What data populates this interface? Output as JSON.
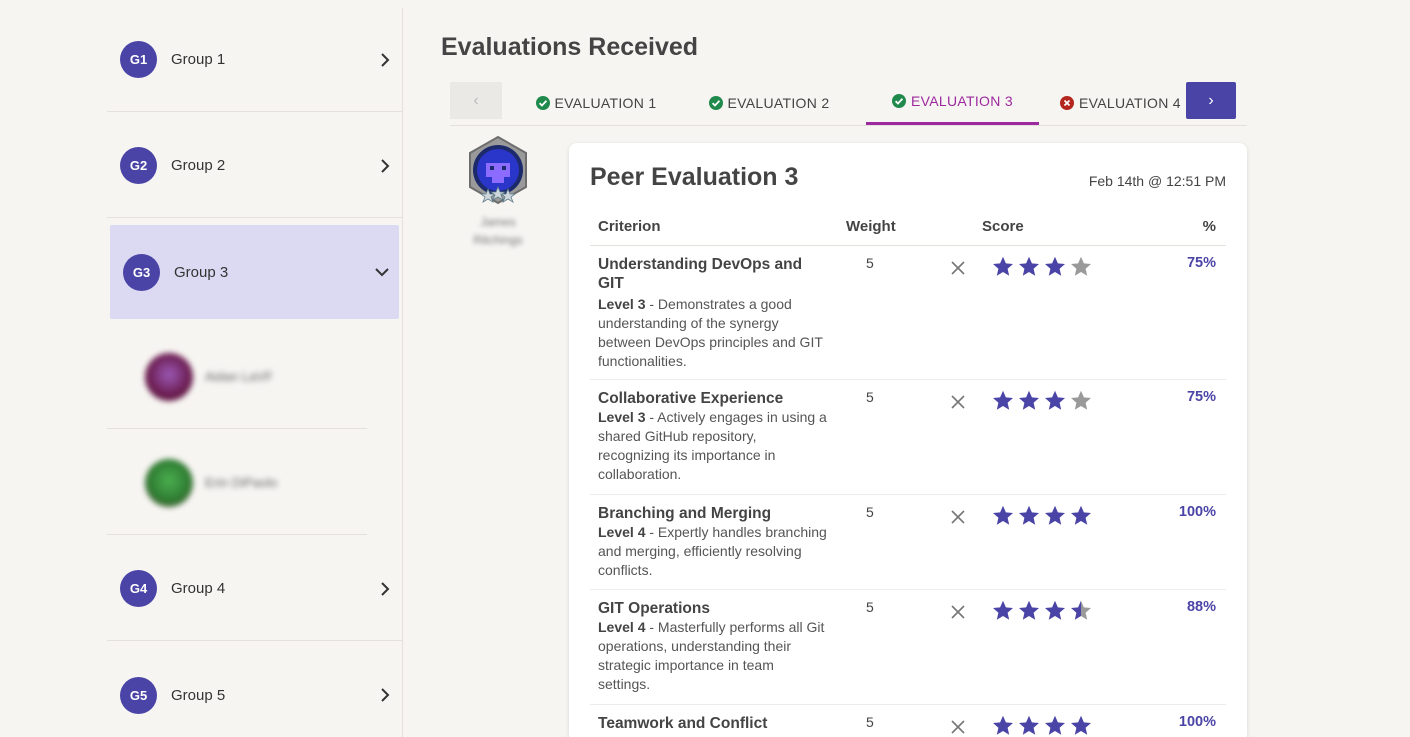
{
  "sidebar": {
    "groups": [
      {
        "initials": "G1",
        "label": "Group 1"
      },
      {
        "initials": "G2",
        "label": "Group 2"
      },
      {
        "initials": "G3",
        "label": "Group 3"
      },
      {
        "initials": "G4",
        "label": "Group 4"
      },
      {
        "initials": "G5",
        "label": "Group 5"
      }
    ],
    "members": [
      {
        "name": "Aidan LaVF"
      },
      {
        "name": "Erin DiPaolo"
      }
    ]
  },
  "main": {
    "title": "Evaluations Received",
    "tabs": [
      {
        "label": "EVALUATION 1",
        "status": "complete"
      },
      {
        "label": "EVALUATION 2",
        "status": "complete"
      },
      {
        "label": "EVALUATION 3",
        "status": "complete"
      },
      {
        "label": "EVALUATION 4",
        "status": "incomplete"
      }
    ],
    "prev_label": "‹",
    "next_label": "›",
    "evaluator": {
      "name_line1": "James",
      "name_line2": "Ritchings"
    },
    "card": {
      "title": "Peer Evaluation 3",
      "date": "Feb 14th @ 12:51 PM",
      "headers": {
        "criterion": "Criterion",
        "weight": "Weight",
        "score": "Score",
        "percent": "%"
      },
      "criteria": [
        {
          "name": "Understanding DevOps and GIT",
          "level": "Level 3",
          "desc": " - Demonstrates a good understanding of the synergy between DevOps principles and GIT functionalities.",
          "weight": "5",
          "rating": 3,
          "percent": "75%"
        },
        {
          "name": "Collaborative Experience",
          "level": "Level 3",
          "desc": " - Actively engages in using a shared GitHub repository, recognizing its importance in collaboration.",
          "weight": "5",
          "rating": 3,
          "percent": "75%"
        },
        {
          "name": "Branching and Merging",
          "level": "Level 4",
          "desc": " - Expertly handles branching and merging, efficiently resolving conflicts.",
          "weight": "5",
          "rating": 4,
          "percent": "100%"
        },
        {
          "name": "GIT Operations",
          "level": "Level 4",
          "desc": " - Masterfully performs all Git operations, understanding their strategic importance in team settings.",
          "weight": "5",
          "rating": 3.5,
          "percent": "88%"
        },
        {
          "name": "Teamwork and Conflict",
          "level": "",
          "desc": "",
          "weight": "5",
          "rating": 4,
          "percent": "100%"
        }
      ]
    }
  },
  "colors": {
    "accent": "#4a44a6",
    "tab_active": "#9c2a9e",
    "complete": "#1f8a4c",
    "incomplete": "#b3261e",
    "star_empty": "#9a9a9a"
  }
}
